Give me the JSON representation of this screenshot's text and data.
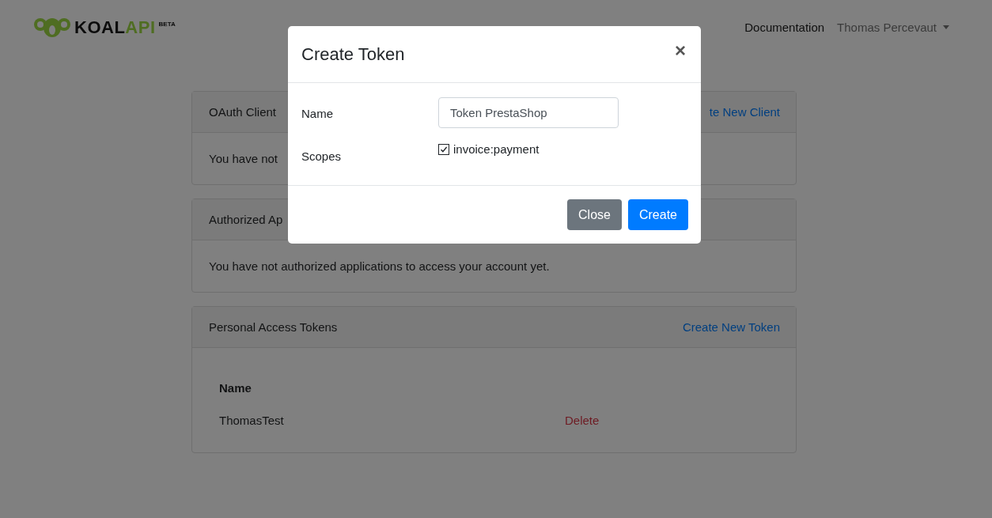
{
  "navbar": {
    "logo": {
      "text": "KOAL",
      "accent": "API",
      "badge": "BETA"
    },
    "links": [
      {
        "label": "Documentation"
      }
    ],
    "user_menu": {
      "label": "Thomas Percevaut"
    }
  },
  "cards": [
    {
      "title": "OAuth Client",
      "action": "te New Client",
      "body": "You have not"
    },
    {
      "title": "Authorized Ap",
      "body": "You have not authorized applications to access your account yet."
    },
    {
      "title": "Personal Access Tokens",
      "action": "Create New Token",
      "table": {
        "columns": [
          "Name"
        ],
        "rows": [
          {
            "name": "ThomasTest",
            "action": "Delete"
          }
        ]
      }
    }
  ],
  "modal": {
    "title": "Create Token",
    "close_icon": "×",
    "fields": [
      {
        "label": "Name",
        "kind": "text",
        "value": "Token PrestaShop"
      },
      {
        "label": "Scopes",
        "kind": "checkboxes",
        "options": [
          {
            "label": "invoice:payment",
            "checked": true
          }
        ]
      }
    ],
    "buttons": [
      {
        "label": "Close",
        "kind": "secondary"
      },
      {
        "label": "Create",
        "kind": "primary"
      }
    ]
  }
}
